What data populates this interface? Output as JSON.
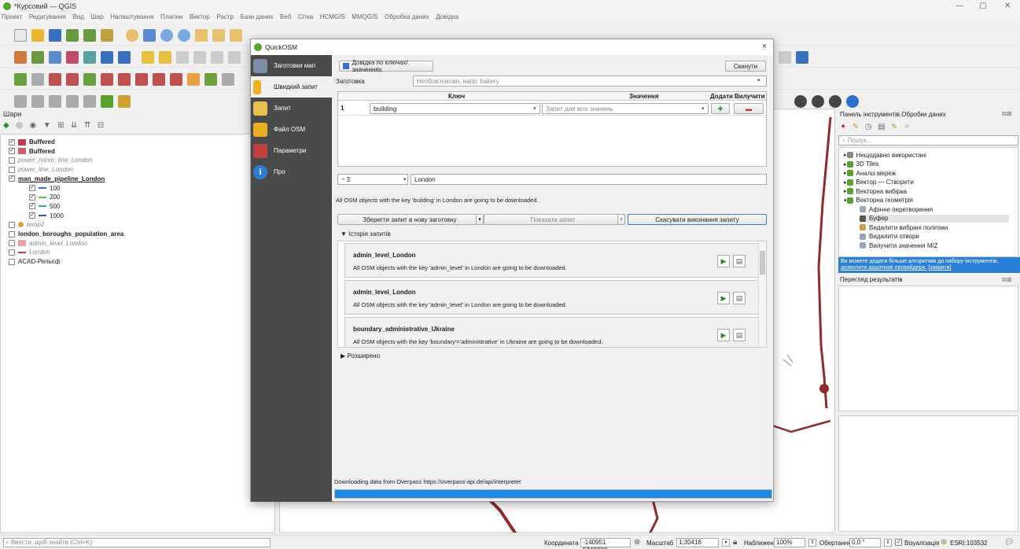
{
  "app": {
    "title": "*Курсовий — QGIS"
  },
  "menu": [
    "Проект",
    "Редагування",
    "Вид",
    "Шар",
    "Налаштування",
    "Плагіни",
    "Вектор",
    "Растр",
    "Бази даних",
    "Веб",
    "Сітка",
    "HCMGIS",
    "MMQGIS",
    "Обробка даних",
    "Довідка"
  ],
  "layers_panel": {
    "title": "Шари",
    "items": [
      {
        "label": "Buffered",
        "checked": true,
        "swatch": "#c23b4e",
        "bold": true,
        "indent": 0
      },
      {
        "label": "Buffered",
        "checked": true,
        "swatch": "#d0596a",
        "bold": true,
        "indent": 0
      },
      {
        "label": "power_minor_line_London",
        "checked": false,
        "italic": true,
        "indent": 0
      },
      {
        "label": "power_line_London",
        "checked": false,
        "italic": true,
        "indent": 0
      },
      {
        "label": "man_made_pipeline_London",
        "checked": true,
        "bold": true,
        "underline": true,
        "indent": 0
      },
      {
        "label": "100",
        "checked": true,
        "line": "#3a72c6",
        "indent": 1
      },
      {
        "label": "200",
        "checked": true,
        "line": "#5fbf4a",
        "indent": 1
      },
      {
        "label": "500",
        "checked": true,
        "line": "#35a3a0",
        "indent": 1
      },
      {
        "label": "1000",
        "checked": true,
        "line": "#2a60c0",
        "indent": 1
      },
      {
        "label": "temp2",
        "checked": false,
        "italic": true,
        "dot": "#e0a030",
        "indent": 0
      },
      {
        "label": "london_boroughs_population_area",
        "checked": false,
        "bold": true,
        "indent": 0
      },
      {
        "label": "admin_level_London",
        "checked": false,
        "italic": true,
        "swatch": "#e8a0a8",
        "indent": 0
      },
      {
        "label": "London",
        "checked": false,
        "italic": true,
        "line": "#b83a4a",
        "indent": 0
      },
      {
        "label": "ACAD-Рельєф",
        "checked": false,
        "indent": 0
      }
    ]
  },
  "dialog": {
    "title": "QuickOSM",
    "close": "×",
    "sidebar": [
      {
        "label": "Заготовки мап",
        "color": "#7a8ea8"
      },
      {
        "label": "Швидкий запит",
        "color": "#f0b020"
      },
      {
        "label": "Запит",
        "color": "#e8c050"
      },
      {
        "label": "Файл OSM",
        "color": "#e8b020"
      },
      {
        "label": "Параметри",
        "color": "#c04040"
      },
      {
        "label": "Про",
        "color": "#2e7cd8"
      }
    ],
    "help_button": "Довідка по ключах/значеннях",
    "reset_button": "Скинути",
    "preset_label": "Заготовка",
    "preset_placeholder": "Необов'язково, напр: bakery",
    "table_headers": {
      "key": "Ключ",
      "value": "Значення",
      "add": "Додати",
      "remove": "Вилучити"
    },
    "row": {
      "num": "1",
      "key": "building",
      "value_placeholder": "Запит для всіх значень"
    },
    "place_type": "3",
    "place": "London",
    "description": "All OSM objects with the key 'building' in London are going to be downloaded.",
    "save_preset": "Зберегти запит в нову заготовку",
    "show_query": "Показати запит",
    "cancel_query": "Скасувати виконання запиту",
    "history_title": "Історія запитів",
    "history": [
      {
        "name": "admin_level_London",
        "desc": "All OSM objects with the key 'admin_level' in London are going to be downloaded."
      },
      {
        "name": "admin_level_London",
        "desc": "All OSM objects with the key 'admin_level' in London are going to be downloaded."
      },
      {
        "name": "boundary_administrative_Ukraine",
        "desc": "All OSM objects with the key 'boundary'='administrative' in Ukraine are going to be downloaded."
      }
    ],
    "advanced": "Розширено",
    "status": "Downloading data from Overpass https://overpass-api.de/api/interpreter",
    "progress": 1.0
  },
  "processing": {
    "title": "Панель інструментів Обробки даних",
    "search_placeholder": "Пошук...",
    "tree": [
      {
        "label": "Нещодавно використані",
        "level": 0,
        "icon": "#888"
      },
      {
        "label": "3D Tiles",
        "level": 0,
        "icon": "#5aa02c"
      },
      {
        "label": "Аналіз мереж",
        "level": 0,
        "icon": "#5aa02c"
      },
      {
        "label": "Вектор — Створити",
        "level": 0,
        "icon": "#5aa02c"
      },
      {
        "label": "Векторна вибірка",
        "level": 0,
        "icon": "#5aa02c"
      },
      {
        "label": "Векторна геометрія",
        "level": 0,
        "icon": "#5aa02c"
      },
      {
        "label": "Афінне перетворення",
        "level": 1,
        "icon": "#9aa6b8"
      },
      {
        "label": "Буфер",
        "level": 1,
        "icon": "#555"
      },
      {
        "label": "Видалити вибрані полігони",
        "level": 1,
        "icon": "#c8a040"
      },
      {
        "label": "Видалити отвори",
        "level": 1,
        "icon": "#9aa6b8"
      },
      {
        "label": "Вилучити значення M/Z",
        "level": 1,
        "icon": "#9aa6b8"
      }
    ],
    "info_text": "Ви можете додати більше алгоритмів до набору інструментів,",
    "info_link": "дозволити додаткові провайдери.",
    "info_close": "[закрити]",
    "results_title": "Перегляд результатів"
  },
  "statusbar": {
    "locator_placeholder": "Ввести, щоб знайти (Ctrl+K)",
    "coord_label": "Координата",
    "coord_value": "-140951 5748300",
    "scale_label": "Масштаб",
    "scale_value": "1:30416",
    "zoom_label": "Наближення",
    "zoom_value": "100%",
    "rotation_label": "Обертання",
    "rotation_value": "0,0 °",
    "render_label": "Візуалізація",
    "crs": "ESRI:103532"
  }
}
